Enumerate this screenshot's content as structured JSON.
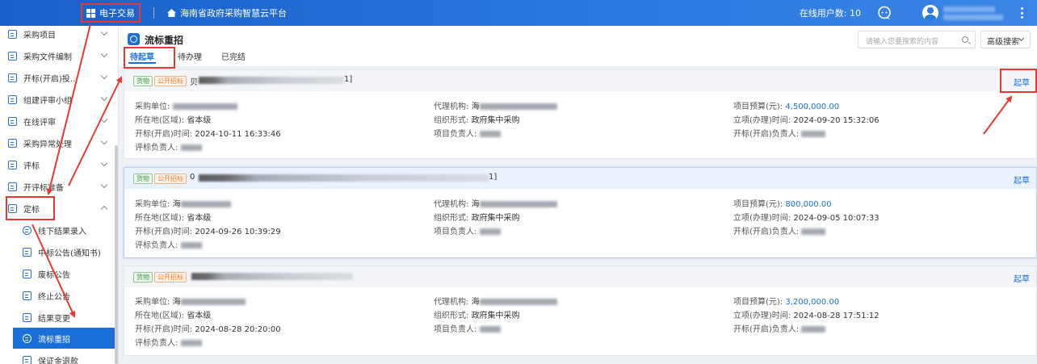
{
  "topbar": {
    "app_label": "电子交易",
    "platform_name": "海南省政府采购智慧云平台",
    "online_users_label": "在线用户数:",
    "online_users_count": "10"
  },
  "sidebar": {
    "items": [
      {
        "label": "采购项目"
      },
      {
        "label": "采购文件编制"
      },
      {
        "label": "开标(开启)投..."
      },
      {
        "label": "组建评审小组"
      },
      {
        "label": "在线评审"
      },
      {
        "label": "采购异常处理"
      },
      {
        "label": "评标"
      },
      {
        "label": "开评标准备"
      },
      {
        "label": "定标"
      }
    ],
    "sub_items": [
      {
        "label": "线下结果录入"
      },
      {
        "label": "中标公告(通知书)"
      },
      {
        "label": "废标公告"
      },
      {
        "label": "终止公告"
      },
      {
        "label": "结果变更"
      },
      {
        "label": "流标重招"
      },
      {
        "label": "保证金退款"
      }
    ]
  },
  "header": {
    "title": "流标重招",
    "search_placeholder": "请输入您要搜索的内容",
    "advanced_search": "高级搜索",
    "tabs": [
      {
        "label": "待起草",
        "active": true
      },
      {
        "label": "待办理",
        "active": false
      },
      {
        "label": "已完结",
        "active": false
      }
    ]
  },
  "labels": {
    "tag_goods": "货物",
    "tag_bid": "公开招标",
    "draft": "起草",
    "purchaser": "采购单位:",
    "region": "所在地(区域):",
    "open_time": "开标(开启)时间:",
    "eval_owner": "评标负责人:",
    "agency": "代理机构:",
    "org_form": "组织形式:",
    "project_owner": "项目负责人:",
    "budget": "项目预算(元):",
    "setup_time": "立项(办理)时间:",
    "open_owner": "开标(开启)负责人:"
  },
  "cards": [
    {
      "title_prefix": "贝",
      "title_suffix": "1]",
      "purchaser_prefix": "",
      "region": "省本级",
      "open_time": "2024-10-11 16:33:46",
      "agency_prefix": "海",
      "org_form": "政府集中采购",
      "budget": "4,500,000.00",
      "setup_time": "2024-09-20 15:32:06"
    },
    {
      "title_prefix": "0",
      "title_suffix": "1]",
      "purchaser_prefix": "海",
      "region": "省本级",
      "open_time": "2024-09-26 10:39:29",
      "agency_prefix": "海",
      "org_form": "政府集中采购",
      "budget": "800,000.00",
      "setup_time": "2024-09-05 10:07:33"
    },
    {
      "title_prefix": "",
      "title_suffix": "",
      "purchaser_prefix": "海",
      "region": "省本级",
      "open_time": "2024-08-28 20:20:00",
      "agency_prefix": "海",
      "org_form": "政府集中采购",
      "budget": "3,200,000.00",
      "setup_time": "2024-08-28 17:51:12"
    }
  ],
  "colors": {
    "primary": "#1a6fd8",
    "topbar": "#2a78e0",
    "annotation_red": "#e53935"
  }
}
